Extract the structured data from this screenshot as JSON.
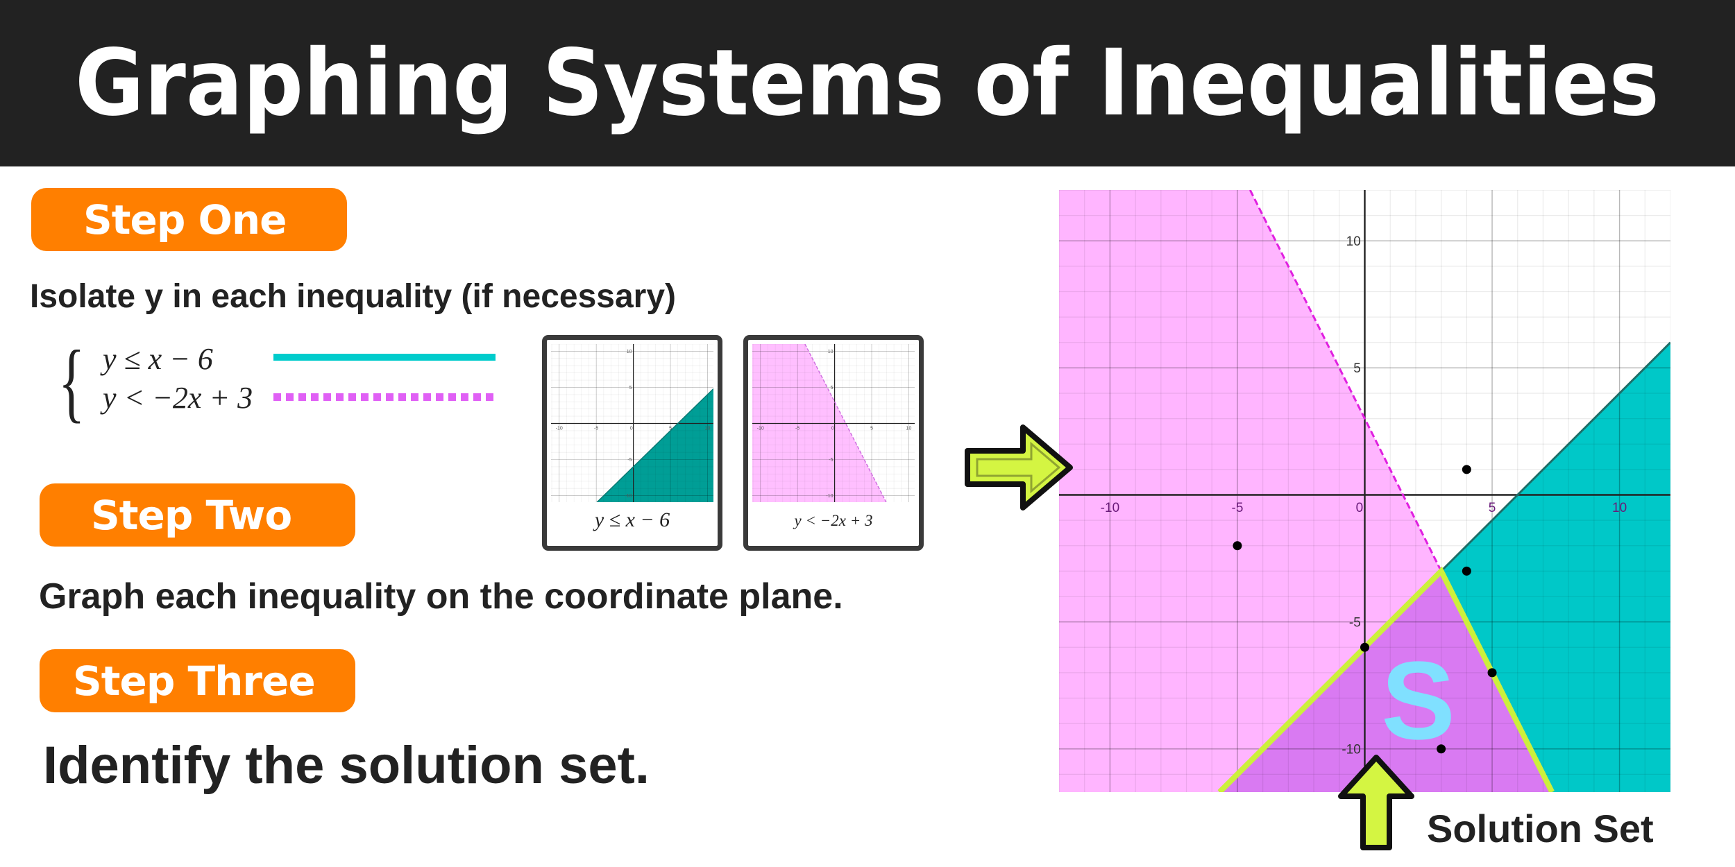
{
  "title": "Graphing Systems of Inequalities",
  "steps": [
    {
      "label": "Step One",
      "text": "Isolate y in each inequality (if necessary)"
    },
    {
      "label": "Step Two",
      "text": "Graph each inequality on the coordinate plane."
    },
    {
      "label": "Step Three",
      "text": "Identify the solution set."
    }
  ],
  "system": {
    "equations": [
      {
        "text": "y ≤ x − 6",
        "line_style": "solid",
        "color": "#00CCCC"
      },
      {
        "text": "y < −2x + 3",
        "line_style": "dotted",
        "color": "#E060F5"
      }
    ]
  },
  "thumbnails": [
    {
      "caption": "y ≤ x − 6",
      "x_range": [
        -11.1,
        10.8
      ],
      "y_range": [
        -10.9,
        11
      ],
      "shows": [
        0
      ],
      "fill": "#009E96"
    },
    {
      "caption": "y < −2x + 3",
      "x_range": [
        -11.1,
        10.8
      ],
      "y_range": [
        -10.9,
        11
      ],
      "shows": [
        1
      ],
      "fill": "#FFBFFF"
    }
  ],
  "callout": "Solution Set",
  "colors": {
    "header_bg": "#222222",
    "step_pill": "#FF7F00",
    "arrow_fill": "#D4F542",
    "solution_outline": "#CCF03C"
  },
  "icons": [
    "arrow-right-icon",
    "arrow-up-icon"
  ],
  "chart_data": {
    "type": "area",
    "x_range": [
      -12,
      12
    ],
    "y_range": [
      -11.7,
      12
    ],
    "x_ticks": [
      -10,
      -5,
      0,
      5,
      10
    ],
    "y_ticks": [
      10,
      5,
      -5,
      -10
    ],
    "grid": true,
    "inequalities": [
      {
        "expr": "y ≤ x − 6",
        "slope": 1,
        "intercept": -6,
        "boundary": "solid",
        "shade": "below",
        "color": "#00C8C8",
        "line_color": "#1E6E68"
      },
      {
        "expr": "y < −2x + 3",
        "slope": -2,
        "intercept": 3,
        "boundary": "dashed",
        "shade": "below",
        "color": "#FFB5FF",
        "line_color": "#E020E0"
      }
    ],
    "overlap_color": "#D97AF2",
    "solution_vertex": [
      3,
      -3
    ],
    "solution_label": "S",
    "solution_label_color": "#80E0FF",
    "points": [
      [
        4,
        1
      ],
      [
        -5,
        -2
      ],
      [
        4,
        -3
      ],
      [
        0,
        -6
      ],
      [
        5,
        -7
      ],
      [
        3,
        -10
      ]
    ]
  }
}
